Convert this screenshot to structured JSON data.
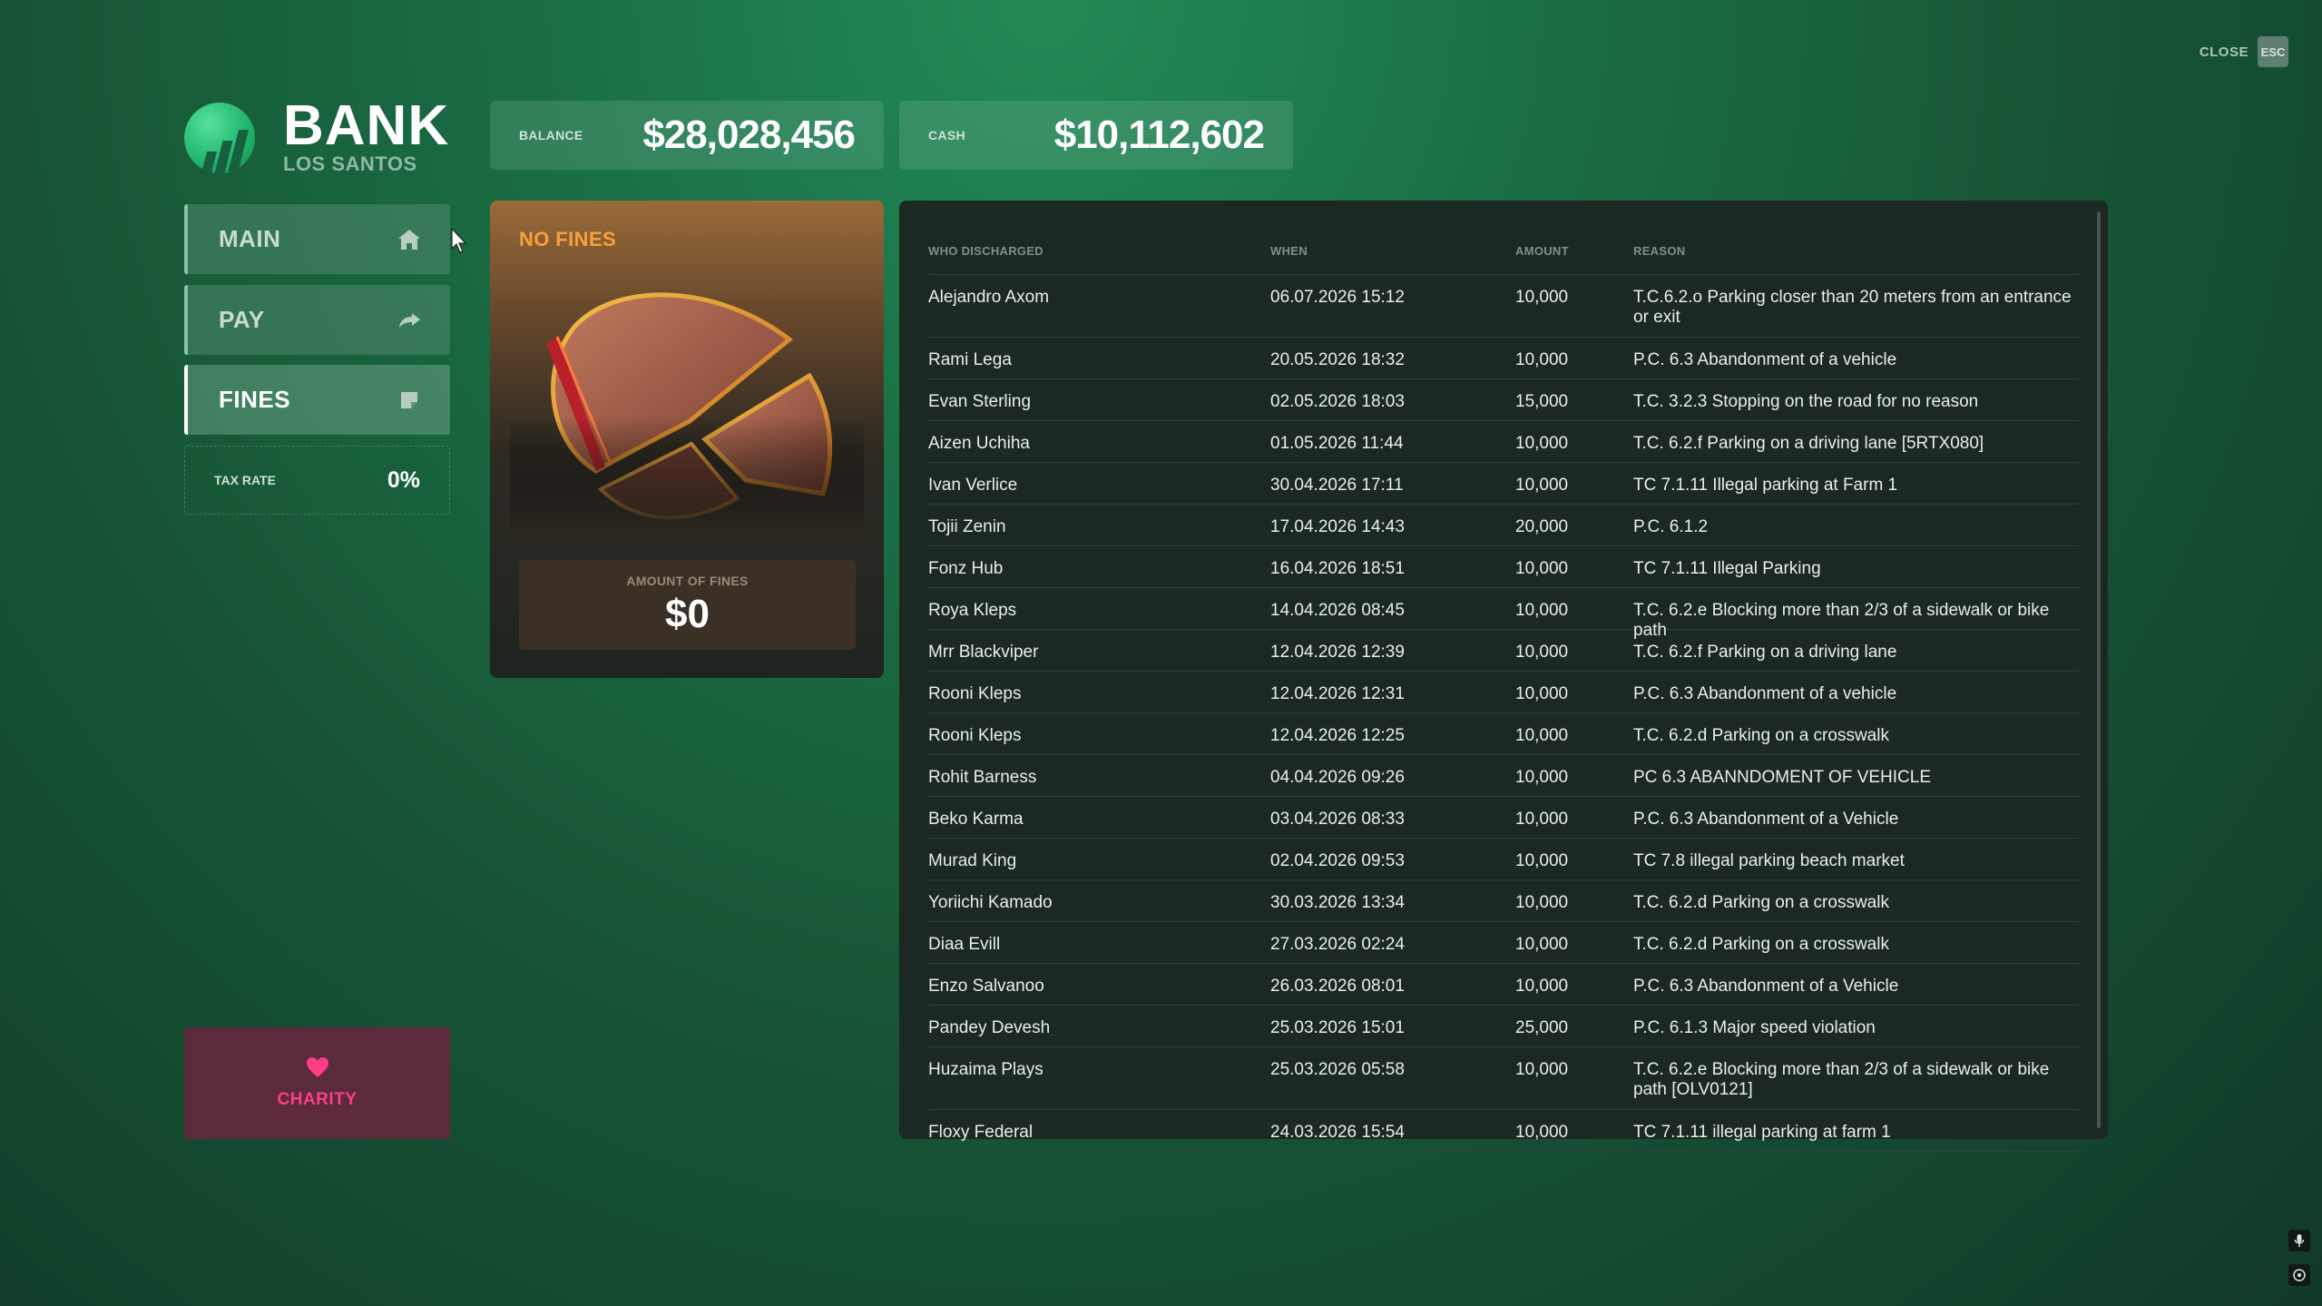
{
  "header": {
    "close_label": "CLOSE",
    "esc_label": "ESC"
  },
  "logo": {
    "title": "BANK",
    "subtitle": "LOS SANTOS"
  },
  "stats": {
    "balance_label": "BALANCE",
    "balance_value": "$28,028,456",
    "cash_label": "CASH",
    "cash_value": "$10,112,602"
  },
  "nav": {
    "items": [
      {
        "label": "MAIN",
        "icon": "home-icon"
      },
      {
        "label": "PAY",
        "icon": "share-arrow-icon"
      },
      {
        "label": "FINES",
        "icon": "sticky-note-icon",
        "active": true
      }
    ],
    "tax_label": "TAX RATE",
    "tax_value": "0%",
    "charity_label": "CHARITY"
  },
  "fines_card": {
    "title": "NO FINES",
    "amount_label": "AMOUNT OF FINES",
    "amount_value": "$0"
  },
  "table": {
    "headers": [
      "WHO DISCHARGED",
      "WHEN",
      "AMOUNT",
      "REASON"
    ],
    "rows": [
      {
        "who": "Alejandro Axom",
        "when": "06.07.2026 15:12",
        "amount": "10,000",
        "reason": "T.C.6.2.o Parking closer than 20 meters from an entrance or exit"
      },
      {
        "who": "Rami Lega",
        "when": "20.05.2026 18:32",
        "amount": "10,000",
        "reason": "P.C. 6.3 Abandonment of a vehicle"
      },
      {
        "who": "Evan Sterling",
        "when": "02.05.2026 18:03",
        "amount": "15,000",
        "reason": "T.C. 3.2.3 Stopping on the road for no reason"
      },
      {
        "who": "Aizen Uchiha",
        "when": "01.05.2026 11:44",
        "amount": "10,000",
        "reason": "T.C. 6.2.f Parking on a driving lane [5RTX080]"
      },
      {
        "who": "Ivan Verlice",
        "when": "30.04.2026 17:11",
        "amount": "10,000",
        "reason": "TC 7.1.11 Illegal parking at Farm 1"
      },
      {
        "who": "Tojii Zenin",
        "when": "17.04.2026 14:43",
        "amount": "20,000",
        "reason": "P.C. 6.1.2"
      },
      {
        "who": "Fonz Hub",
        "when": "16.04.2026 18:51",
        "amount": "10,000",
        "reason": "TC 7.1.11 Illegal Parking"
      },
      {
        "who": "Roya Kleps",
        "when": "14.04.2026 08:45",
        "amount": "10,000",
        "reason": "T.C. 6.2.e Blocking more than 2/3 of a sidewalk or bike path"
      },
      {
        "who": "Mrr Blackviper",
        "when": "12.04.2026 12:39",
        "amount": "10,000",
        "reason": "T.C. 6.2.f Parking on a driving lane"
      },
      {
        "who": "Rooni Kleps",
        "when": "12.04.2026 12:31",
        "amount": "10,000",
        "reason": "P.C. 6.3 Abandonment of a vehicle"
      },
      {
        "who": "Rooni Kleps",
        "when": "12.04.2026 12:25",
        "amount": "10,000",
        "reason": "T.C. 6.2.d Parking on a crosswalk"
      },
      {
        "who": "Rohit Barness",
        "when": "04.04.2026 09:26",
        "amount": "10,000",
        "reason": "PC 6.3 ABANNDOMENT OF VEHICLE"
      },
      {
        "who": "Beko Karma",
        "when": "03.04.2026 08:33",
        "amount": "10,000",
        "reason": "P.C. 6.3 Abandonment of a Vehicle"
      },
      {
        "who": "Murad King",
        "when": "02.04.2026 09:53",
        "amount": "10,000",
        "reason": "TC 7.8 illegal parking beach market"
      },
      {
        "who": "Yoriichi Kamado",
        "when": "30.03.2026 13:34",
        "amount": "10,000",
        "reason": "T.C. 6.2.d Parking on a crosswalk"
      },
      {
        "who": "Diaa Evill",
        "when": "27.03.2026 02:24",
        "amount": "10,000",
        "reason": "T.C. 6.2.d Parking on a crosswalk"
      },
      {
        "who": "Enzo Salvanoo",
        "when": "26.03.2026 08:01",
        "amount": "10,000",
        "reason": "P.C. 6.3 Abandonment of a Vehicle"
      },
      {
        "who": "Pandey Devesh",
        "when": "25.03.2026 15:01",
        "amount": "25,000",
        "reason": "P.C. 6.1.3 Major speed violation"
      },
      {
        "who": "Huzaima Plays",
        "when": "25.03.2026 05:58",
        "amount": "10,000",
        "reason": "T.C. 6.2.e Blocking more than 2/3 of a sidewalk or bike path [OLV0121]"
      },
      {
        "who": "Floxy Federal",
        "when": "24.03.2026 15:54",
        "amount": "10,000",
        "reason": "TC 7.1.11 illegal parking at farm 1"
      }
    ]
  },
  "colors": {
    "accent_fines": "#f7a13c",
    "charity": "#ff3c86",
    "logo_green": "#1fb26a"
  }
}
